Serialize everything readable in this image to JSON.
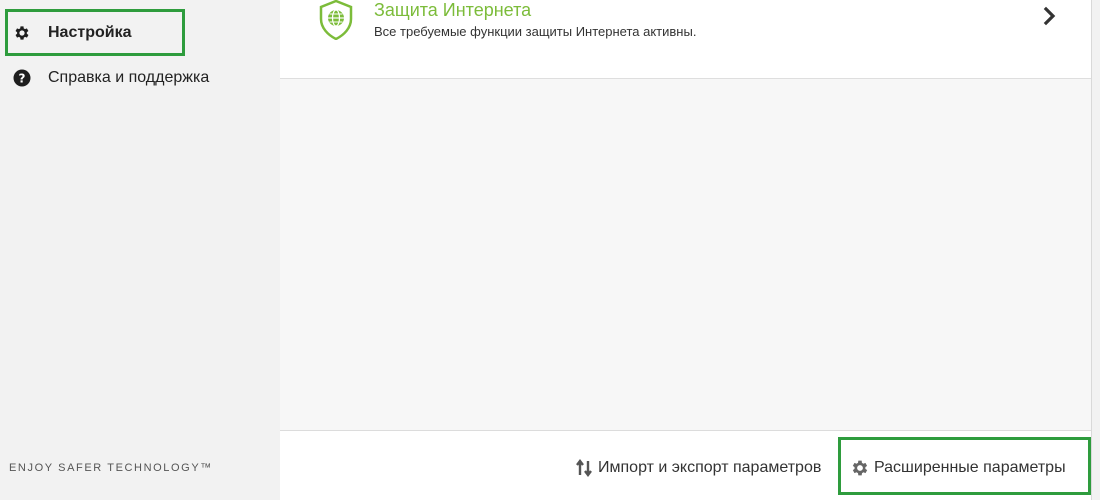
{
  "sidebar": {
    "items": [
      {
        "label": "Настройка",
        "icon": "gear-icon"
      },
      {
        "label": "Справка и поддержка",
        "icon": "help-circle-icon"
      }
    ],
    "tagline": "ENJOY SAFER TECHNOLOGY™"
  },
  "main": {
    "card": {
      "title": "Защита Интернета",
      "subtitle": "Все требуемые функции защиты Интернета активны.",
      "icon": "shield-globe-icon"
    },
    "footer": {
      "import_export_label": "Импорт и экспорт параметров",
      "advanced_label": "Расширенные параметры"
    }
  },
  "colors": {
    "accent_green": "#7cbc3a",
    "highlight_border": "#2e9c3d",
    "sidebar_bg": "#f2f2f2",
    "main_bg": "#f7f7f7"
  }
}
